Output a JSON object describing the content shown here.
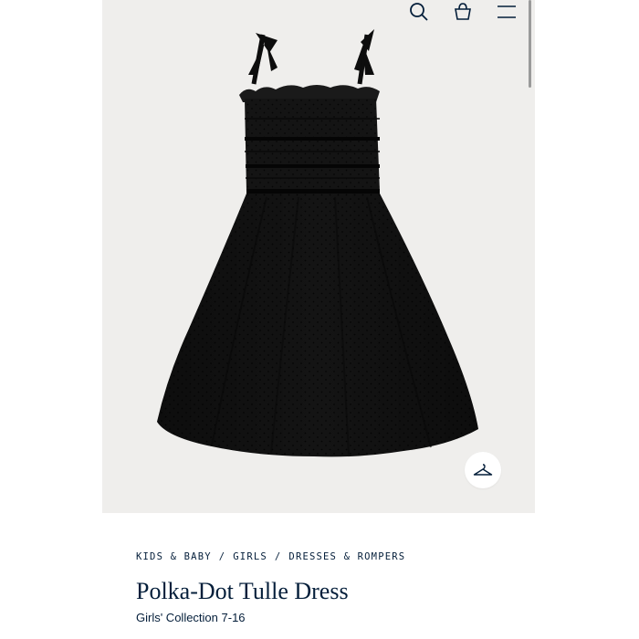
{
  "header": {
    "icons": [
      "search-icon",
      "shopping-bag-icon",
      "menu-icon"
    ]
  },
  "product_image": {
    "alt": "Black polka-dot tulle dress with velvet bow straps",
    "background": "#efeeec",
    "hanger_icon": "hanger-icon"
  },
  "breadcrumb": {
    "items": [
      "KIDS & BABY",
      "GIRLS",
      "DRESSES & ROMPERS"
    ],
    "separator": "/"
  },
  "product": {
    "title": "Polka-Dot Tulle Dress",
    "collection": "Girls' Collection 7-16"
  },
  "colors": {
    "text_navy": "#041e3a",
    "dress_black": "#121212"
  }
}
